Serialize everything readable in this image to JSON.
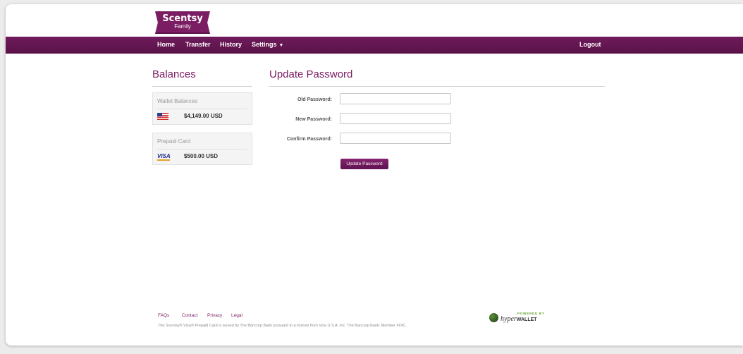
{
  "brand": {
    "name": "Scentsy",
    "sub": "Family"
  },
  "nav": {
    "items": [
      {
        "label": "Home"
      },
      {
        "label": "Transfer"
      },
      {
        "label": "History"
      },
      {
        "label": "Settings"
      }
    ],
    "logout": "Logout"
  },
  "balances": {
    "title": "Balances",
    "wallet": {
      "title": "Wallet Balances",
      "amount": "$4,149.00 USD",
      "icon": "us-flag-icon"
    },
    "prepaid": {
      "title": "Prepaid Card",
      "amount": "$500.00 USD",
      "icon": "visa-icon",
      "card_brand": "VISA"
    }
  },
  "form": {
    "title": "Update Password",
    "old_label": "Old Password:",
    "new_label": "New Password:",
    "confirm_label": "Confirm Password:",
    "old_value": "",
    "new_value": "",
    "confirm_value": "",
    "submit": "Update Password"
  },
  "footer": {
    "links": [
      "FAQs",
      "Contact",
      "Privacy",
      "Legal"
    ],
    "legal": "The Scentsy® Visa® Prepaid Card is issued by The Bancorp Bank pursuant to a license from Visa U.S.A. Inc. The Bancorp Bank; Member FDIC.",
    "powered": "POWERED BY",
    "hyper": "hyper",
    "wallet": "WALLET"
  },
  "colors": {
    "accent": "#7b1d63",
    "nav": "#6f1b5c"
  }
}
